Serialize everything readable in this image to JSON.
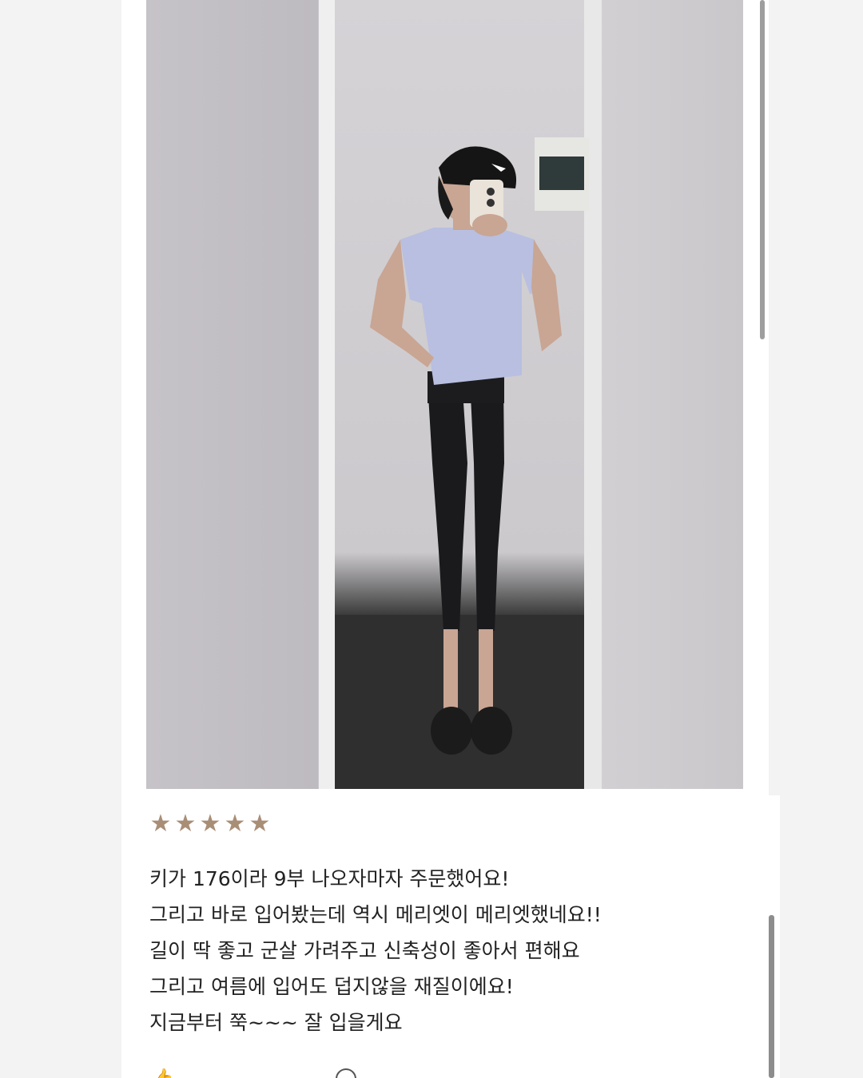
{
  "review": {
    "rating": 5,
    "rating_max": 5,
    "star_color": "#a98e76",
    "stars": [
      "★",
      "★",
      "★",
      "★",
      "★"
    ],
    "lines": [
      "키가 176이라 9부 나오자마자 주문했어요!",
      "그리고 바로 입어봤는데 역시 메리엣이 메리엣했네요!!",
      "길이 딱 좋고 군살 가려주고 신축성이 좋아서 편해요",
      "그리고 여름에 입어도 덥지않을 재질이에요!",
      "지금부터 쭉~~~ 잘 입을게요"
    ]
  },
  "icons": {
    "photo": "review-photo-image",
    "helpful": "thumbs-up-icon",
    "comment": "comment-bubble-icon"
  }
}
